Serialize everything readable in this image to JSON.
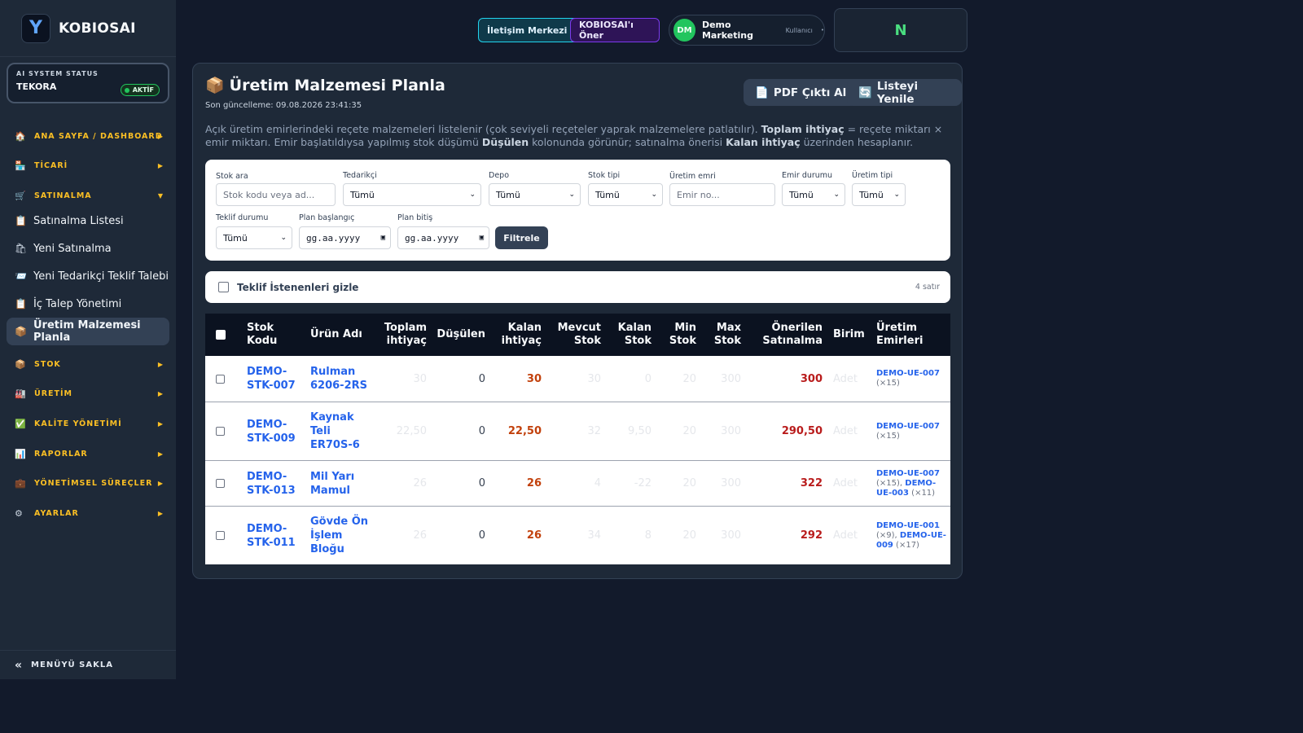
{
  "brand": {
    "logo_letter": "Y",
    "name": "KOBIOSAI"
  },
  "ai_status": {
    "title": "AI SYSTEM STATUS",
    "name": "TEKORA",
    "badge": "AKTİF"
  },
  "nav": {
    "dashboard": "ANA SAYFA / DASHBOARD",
    "ticari": "TİCARİ",
    "satinalma": "SATINALMA",
    "sub": [
      "Satınalma Listesi",
      "Yeni Satınalma",
      "Yeni Tedarikçi Teklif Talebi",
      "İç Talep Yönetimi",
      "Üretim Malzemesi Planla"
    ],
    "stok": "STOK",
    "uretim": "ÜRETİM",
    "kalite": "KALİTE YÖNETİMİ",
    "raporlar": "RAPORLAR",
    "yonetimsel": "YÖNETİMSEL SÜREÇLER",
    "ayarlar": "AYARLAR",
    "hide": "MENÜYÜ SAKLA"
  },
  "topbar": {
    "contact": "İletişim Merkezi",
    "suggest": "KOBIOSAI'ı Öner",
    "user_initials": "DM",
    "user_name": "Demo Marketing",
    "user_role": "Kullanıcı",
    "n_badge": "N"
  },
  "page": {
    "title": "Üretim Malzemesi Planla",
    "updated": "Son güncelleme: 09.08.2026 23:41:35",
    "pdf_btn": "PDF Çıktı Al",
    "refresh_btn": "Listeyi Yenile",
    "desc": {
      "p1": "Açık üretim emirlerindeki reçete malzemeleri listelenir (çok seviyeli reçeteler yaprak malzemelere patlatılır). ",
      "b1": "Toplam ihtiyaç",
      "p2": " = reçete miktarı × emir miktarı. Emir başlatıldıysa yapılmış stok düşümü ",
      "b2": "Düşülen",
      "p3": " kolonunda görünür; satınalma önerisi ",
      "b3": "Kalan ihtiyaç",
      "p4": " üzerinden hesaplanır."
    }
  },
  "filters": {
    "stok_ara": {
      "label": "Stok ara",
      "placeholder": "Stok kodu veya ad..."
    },
    "tedarikci": {
      "label": "Tedarikçi",
      "value": "Tümü"
    },
    "depo": {
      "label": "Depo",
      "value": "Tümü"
    },
    "stok_tipi": {
      "label": "Stok tipi",
      "value": "Tümü"
    },
    "uretim_emri": {
      "label": "Üretim emri",
      "placeholder": "Emir no..."
    },
    "emir_durumu": {
      "label": "Emir durumu",
      "value": "Tümü"
    },
    "uretim_tipi": {
      "label": "Üretim tipi",
      "value": "Tümü"
    },
    "teklif_durumu": {
      "label": "Teklif durumu",
      "value": "Tümü"
    },
    "plan_baslangic": {
      "label": "Plan başlangıç",
      "value": "gg.aa.yyyy"
    },
    "plan_bitis": {
      "label": "Plan bitiş",
      "value": "gg.aa.yyyy"
    },
    "filter_btn": "Filtrele"
  },
  "hide_quoted": {
    "label": "Teklif İstenenleri gizle",
    "count": "4 satır"
  },
  "table": {
    "headers": {
      "stok_kodu": [
        "Stok",
        "Kodu"
      ],
      "urun_adi": "Ürün Adı",
      "toplam": [
        "Toplam",
        "ihtiyaç"
      ],
      "dusulen": "Düşülen",
      "kalan_ihtiyac": [
        "Kalan",
        "ihtiyaç"
      ],
      "mevcut": [
        "Mevcut",
        "Stok"
      ],
      "kalan_stok": [
        "Kalan",
        "Stok"
      ],
      "min": [
        "Min",
        "Stok"
      ],
      "max": [
        "Max",
        "Stok"
      ],
      "onerilen": [
        "Önerilen",
        "Satınalma"
      ],
      "birim": "Birim",
      "emirler": [
        "Üretim",
        "Emirleri"
      ]
    },
    "rows": [
      {
        "code": [
          "DEMO-",
          "STK-007"
        ],
        "name": [
          "Rulman",
          "6206-2RS"
        ],
        "toplam": "30",
        "dusulen": "0",
        "kalan": "30",
        "mevcut": "30",
        "kalan_stok": "0",
        "min": "20",
        "max": "300",
        "onerilen": "300",
        "birim": "Adet",
        "orders": {
          "l1": "DEMO-UE-007",
          "l2": "(×15)"
        }
      },
      {
        "code": [
          "DEMO-",
          "STK-009"
        ],
        "name": [
          "Kaynak",
          "Teli",
          "ER70S-6"
        ],
        "toplam": "22,50",
        "dusulen": "0",
        "kalan": "22,50",
        "mevcut": "32",
        "kalan_stok": "9,50",
        "min": "20",
        "max": "300",
        "onerilen": "290,50",
        "birim": "Adet",
        "orders": {
          "l1": "DEMO-UE-007",
          "l2": "(×15)"
        }
      },
      {
        "code": [
          "DEMO-",
          "STK-013"
        ],
        "name": [
          "Mil Yarı",
          "Mamul"
        ],
        "toplam": "26",
        "dusulen": "0",
        "kalan": "26",
        "mevcut": "4",
        "kalan_stok": "-22",
        "min": "20",
        "max": "300",
        "onerilen": "322",
        "birim": "Adet",
        "orders": {
          "l1": "DEMO-UE-007",
          "l2a": "(×15), ",
          "l2b": "DEMO-",
          "l3a": "UE-003",
          "l3b": " (×11)"
        }
      },
      {
        "code": [
          "DEMO-",
          "STK-011"
        ],
        "name": [
          "Gövde Ön",
          "İşlem",
          "Bloğu"
        ],
        "toplam": "26",
        "dusulen": "0",
        "kalan": "26",
        "mevcut": "34",
        "kalan_stok": "8",
        "min": "20",
        "max": "300",
        "onerilen": "292",
        "birim": "Adet",
        "orders": {
          "l1": "DEMO-UE-001",
          "l2a": "(×9), ",
          "l2b": "DEMO-UE-",
          "l3a": "009",
          "l3b": " (×17)"
        }
      }
    ]
  }
}
